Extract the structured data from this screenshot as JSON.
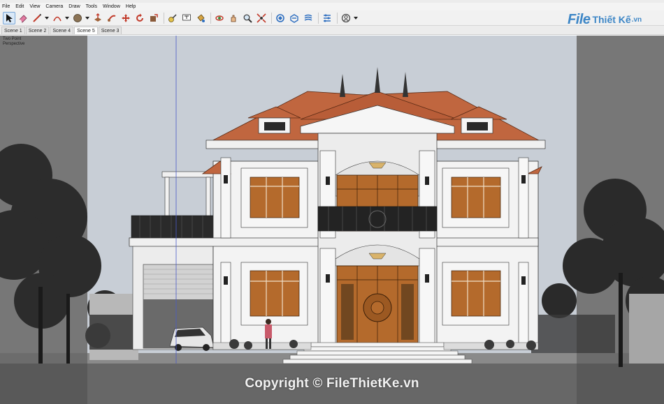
{
  "menu": [
    "File",
    "Edit",
    "View",
    "Camera",
    "Draw",
    "Tools",
    "Window",
    "Help"
  ],
  "toolbar": {
    "tools": [
      {
        "icon": "select-arrow-icon",
        "active": true
      },
      {
        "icon": "eraser-icon"
      },
      {
        "icon": "pencil-line-icon",
        "dropdown": true
      },
      {
        "icon": "arc-icon",
        "dropdown": true
      },
      {
        "icon": "shape-circle-icon",
        "dropdown": true
      },
      {
        "icon": "push-pull-icon"
      },
      {
        "icon": "follow-me-icon"
      },
      {
        "icon": "move-icon"
      },
      {
        "icon": "rotate-icon"
      },
      {
        "icon": "scale-icon"
      },
      {
        "icon": "tape-measure-icon"
      },
      {
        "icon": "text-label-icon"
      },
      {
        "icon": "paint-bucket-icon"
      },
      {
        "icon": "orbit-icon"
      },
      {
        "icon": "pan-icon"
      },
      {
        "icon": "zoom-icon"
      },
      {
        "icon": "zoom-extents-icon"
      },
      {
        "icon": "warehouse-icon"
      },
      {
        "icon": "extension-warehouse-icon"
      },
      {
        "icon": "layout-icon"
      },
      {
        "icon": "extension-manager-icon"
      },
      {
        "icon": "account-icon",
        "dropdown": true
      }
    ]
  },
  "scenes": {
    "tabs": [
      "Scene 1",
      "Scene 2",
      "Scene 4",
      "Scene 5",
      "Scene 3"
    ],
    "active": "Scene 5"
  },
  "viewport": {
    "camera_line1": "Two Point",
    "camera_line2": "Perspective"
  },
  "watermark": {
    "text": "Copyright © FileThietKe.vn"
  },
  "logo": {
    "file": "File",
    "rest": "Thiết Kế",
    "suffix": ".vn"
  },
  "colors": {
    "roof": "#c0663f",
    "wood": "#b46a2c",
    "sky": "#c6cdd6",
    "accent": "#3d86c6"
  }
}
